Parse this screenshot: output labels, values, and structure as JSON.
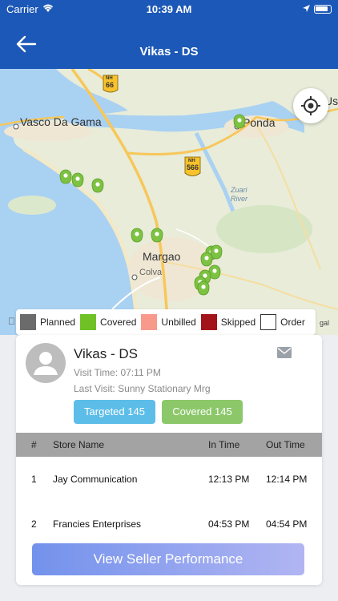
{
  "status_bar": {
    "carrier": "Carrier",
    "time": "10:39 AM"
  },
  "nav": {
    "title": "Vikas  - DS",
    "back_icon": "back-arrow-icon"
  },
  "map": {
    "labels": {
      "vasco": "Vasco Da Gama",
      "ponda": "Ponda",
      "margao": "Margao",
      "colva": "Colva",
      "zuari": "Zuari",
      "river": "River",
      "us": "Us",
      "nh66": "66",
      "nh566": "566",
      "nh": "NH",
      "legal": "gal"
    },
    "pin_color": "#7dc242"
  },
  "legend": [
    {
      "label": "Planned",
      "color": "#6b6b6b"
    },
    {
      "label": "Covered",
      "color": "#6fc126"
    },
    {
      "label": "Unbilled",
      "color": "#f79a8c"
    },
    {
      "label": "Skipped",
      "color": "#a3141a"
    },
    {
      "label": "Order",
      "color": "#ffffff"
    }
  ],
  "seller": {
    "name": "Vikas  - DS",
    "visit_time": "Visit Time: 07:11 PM",
    "last_visit": "Last Visit: Sunny Stationary Mrg",
    "targeted": "Targeted 145",
    "covered": "Covered 145"
  },
  "table": {
    "headers": {
      "num": "#",
      "store": "Store Name",
      "in": "In Time",
      "out": "Out Time"
    },
    "rows": [
      {
        "num": "1",
        "store": "Jay Communication",
        "in": "12:13 PM",
        "out": "12:14 PM"
      },
      {
        "num": "2",
        "store": "Francies Enterprises",
        "in": "04:53 PM",
        "out": "04:54 PM"
      }
    ]
  },
  "cta": {
    "label": "View Seller Performance"
  }
}
